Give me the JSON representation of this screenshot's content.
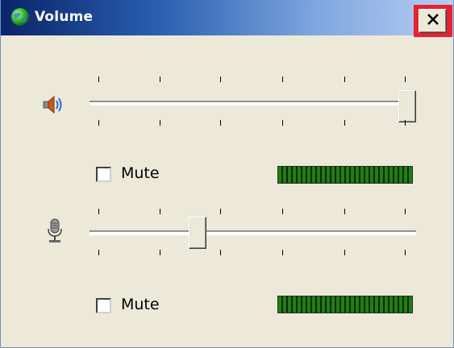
{
  "window": {
    "title": "Volume",
    "close_icon": "close-icon"
  },
  "speaker": {
    "icon": "speaker-icon",
    "slider_level": 1.0,
    "mute_label": "Mute",
    "mute_checked": false,
    "meter_level": 1.0
  },
  "microphone": {
    "icon": "microphone-icon",
    "slider_level": 0.32,
    "mute_label": "Mute",
    "mute_checked": false,
    "meter_level": 1.0
  },
  "colors": {
    "close_highlight": "#e8212d",
    "meter_green": "#1f7f14"
  }
}
